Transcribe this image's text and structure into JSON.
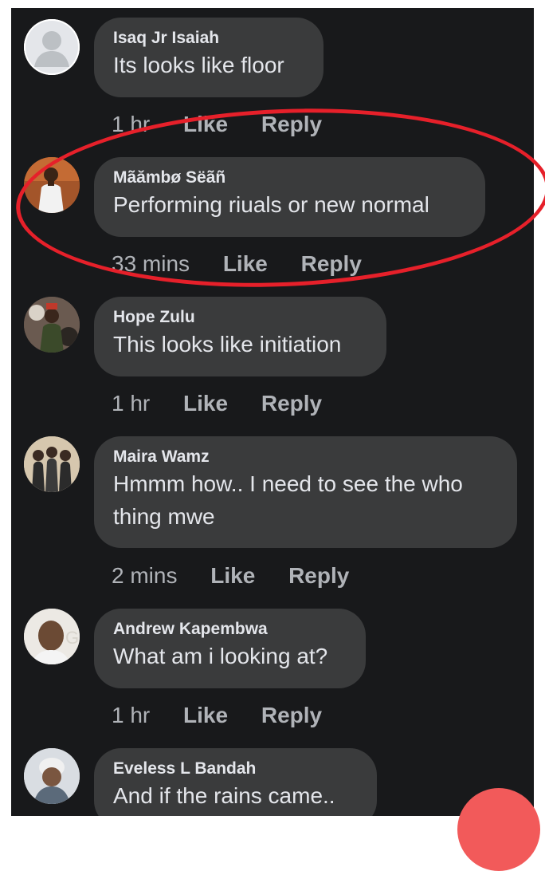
{
  "actions": {
    "like": "Like",
    "reply": "Reply"
  },
  "comments": [
    {
      "name": "Isaq Jr Isaiah",
      "text": "Its looks like floor",
      "time": "1 hr",
      "avatar": "default-user-avatar"
    },
    {
      "name": "Mãămbø  Sëãñ",
      "text": "Performing riuals or new normal",
      "time": "33 mins",
      "avatar": "person-photo-avatar"
    },
    {
      "name": "Hope Zulu",
      "text": "This looks like initiation",
      "time": "1 hr",
      "avatar": "person-photo-avatar"
    },
    {
      "name": "Maira Wamz",
      "text": "Hmmm how.. I need to see the who thing mwe",
      "time": "2 mins",
      "avatar": "group-photo-avatar"
    },
    {
      "name": "Andrew Kapembwa",
      "text": "What am i looking at?",
      "time": "1 hr",
      "avatar": "person-photo-avatar"
    },
    {
      "name": "Eveless L Bandah",
      "text": "And if the rains came..",
      "time": "",
      "avatar": "child-photo-avatar"
    }
  ],
  "colors": {
    "panel_bg": "#18191b",
    "bubble_bg": "#3a3b3c",
    "text_primary": "#e4e6eb",
    "text_secondary": "#b0b3b8",
    "highlight_ring": "#e6202a",
    "fab": "#f25a5a"
  }
}
